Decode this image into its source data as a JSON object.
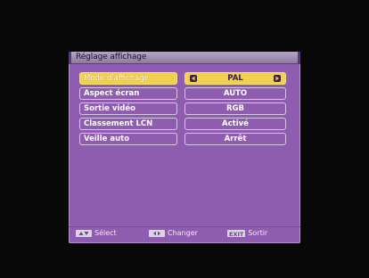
{
  "menu": {
    "title": "Réglage affichage",
    "rows": [
      {
        "label": "Mode d'affichage",
        "value": "PAL",
        "selected": true
      },
      {
        "label": "Aspect écran",
        "value": "AUTO",
        "selected": false
      },
      {
        "label": "Sortie vidéo",
        "value": "RGB",
        "selected": false
      },
      {
        "label": "Classement LCN",
        "value": "Activé",
        "selected": false
      },
      {
        "label": "Veille auto",
        "value": "Arrêt",
        "selected": false
      }
    ]
  },
  "footer": {
    "select_label": "Sélect",
    "change_label": "Changer",
    "exit_key": "EXIT",
    "exit_label": "Sortir"
  },
  "colors": {
    "panel": "#8f5db0",
    "highlight": "#f0d050",
    "background": "#080808"
  },
  "icons": {
    "select_key": "up-down-arrows-icon",
    "change_key": "left-right-arrows-icon",
    "value_prev": "left-arrow-icon",
    "value_next": "right-arrow-icon"
  }
}
